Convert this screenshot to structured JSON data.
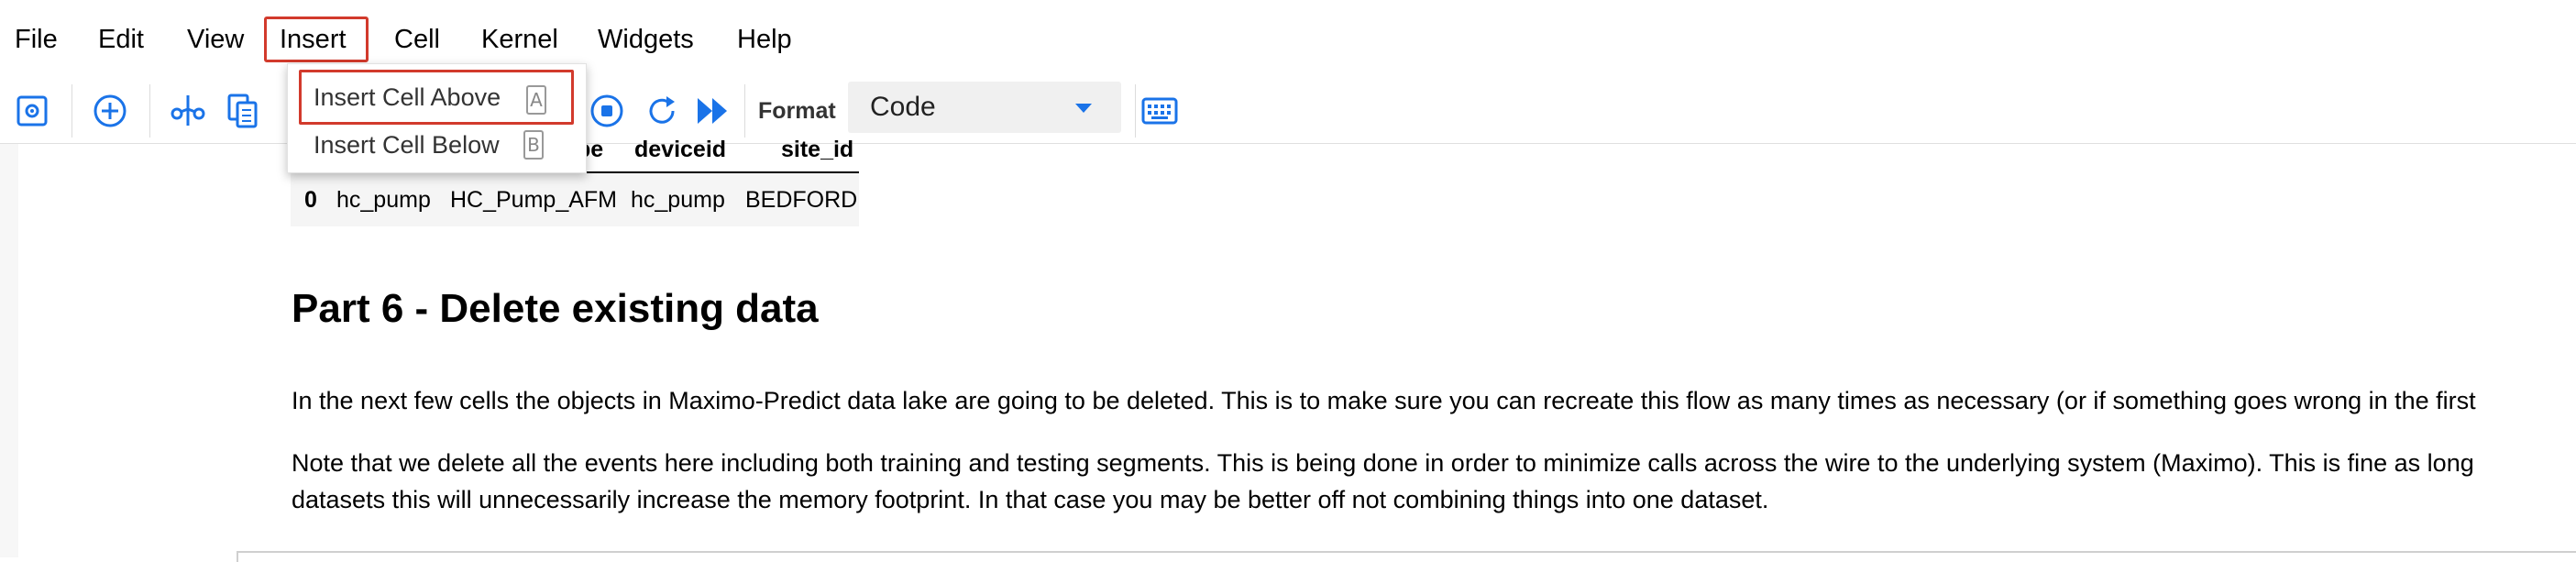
{
  "menubar": {
    "items": [
      "File",
      "Edit",
      "View",
      "Insert",
      "Cell",
      "Kernel",
      "Widgets",
      "Help"
    ]
  },
  "toolbar": {
    "format_label": "Format",
    "format_value": "Code",
    "accent_color": "#1a73e8"
  },
  "dropdown": {
    "items": [
      {
        "label": "Insert Cell Above",
        "shortcut": "A"
      },
      {
        "label": "Insert Cell Below",
        "shortcut": "B"
      }
    ]
  },
  "dataframe": {
    "columns": [
      "",
      "pe",
      "deviceid",
      "site_id"
    ],
    "rows": [
      [
        "0",
        "hc_pump",
        "HC_Pump_AFM",
        "hc_pump",
        "BEDFORD"
      ]
    ]
  },
  "markdown": {
    "title": "Part 6 - Delete existing data",
    "paragraph1": "In the next few cells the objects in Maximo-Predict data lake are going to be deleted. This is to make sure you can recreate this flow as many times as necessary (or if something goes wrong in the first",
    "paragraph2_line1": "Note that we delete all the events here including both training and testing segments. This is being done in order to minimize calls across the wire to the underlying system (Maximo). This is fine as long",
    "paragraph2_line2": "datasets this will unnecessarily increase the memory footprint. In that case you may be better off not combining things into one dataset."
  },
  "colors": {
    "highlight": "#d23a2c",
    "icon_blue": "#1a73e8"
  }
}
